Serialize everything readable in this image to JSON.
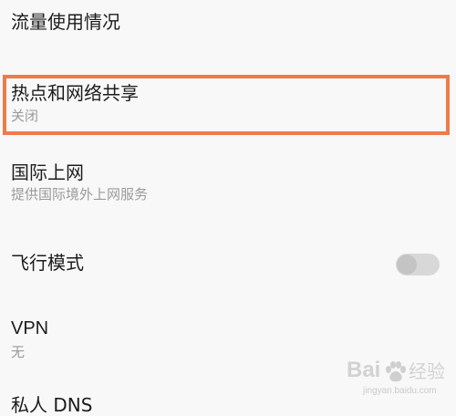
{
  "settings": {
    "usage": {
      "title": "流量使用情况"
    },
    "hotspot": {
      "title": "热点和网络共享",
      "subtitle": "关闭"
    },
    "international": {
      "title": "国际上网",
      "subtitle": "提供国际境外上网服务"
    },
    "airplane": {
      "title": "飞行模式",
      "toggle_on": false
    },
    "vpn": {
      "title": "VPN",
      "subtitle": "无"
    },
    "private_dns": {
      "title": "私人 DNS"
    }
  },
  "highlight_color": "#ef7a4a",
  "watermark": {
    "logo_text": "Bai",
    "word": "经验",
    "url": "jingyan.baidu.com"
  }
}
